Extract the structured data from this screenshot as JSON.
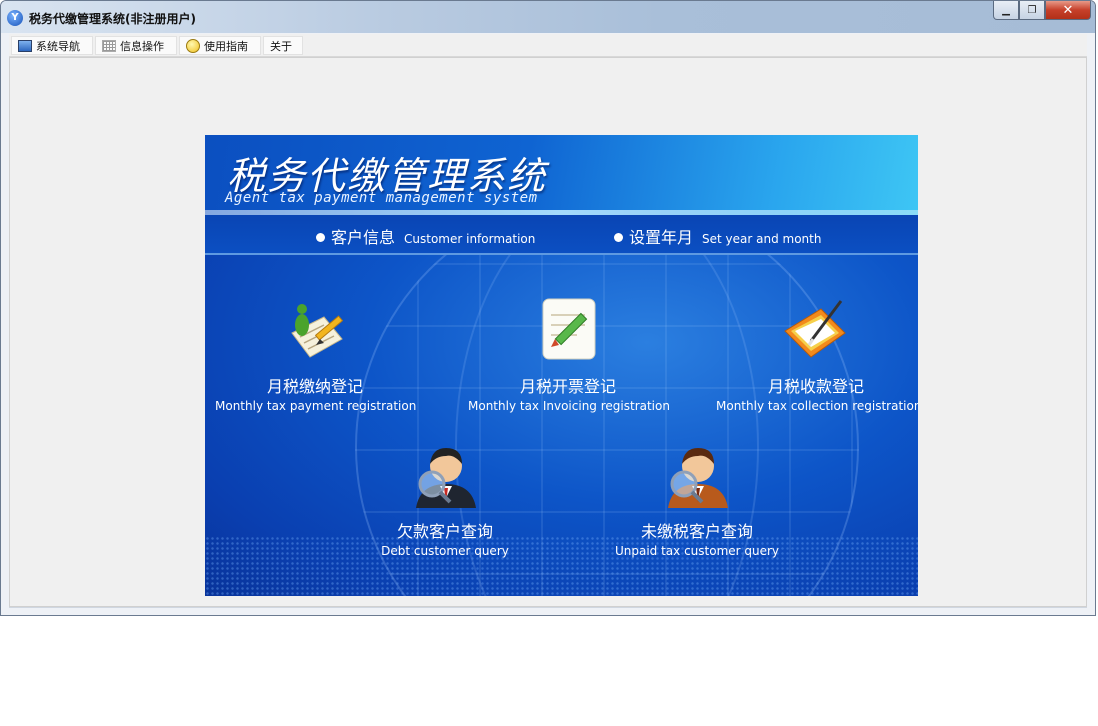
{
  "window": {
    "title": "税务代缴管理系统(非注册用户)",
    "minimize_glyph": "▁",
    "restore_glyph": "❐",
    "close_glyph": "✕"
  },
  "menu": {
    "items": [
      {
        "label": "系统导航",
        "icon": "nav-window-icon"
      },
      {
        "label": "信息操作",
        "icon": "grid-icon"
      },
      {
        "label": "使用指南",
        "icon": "smiley-icon"
      },
      {
        "label": "关于",
        "icon": ""
      }
    ]
  },
  "banner": {
    "title": "税务代缴管理系统",
    "subtitle": "Agent tax payment management system",
    "links": [
      {
        "cn": "客户信息",
        "en": "Customer information"
      },
      {
        "cn": "设置年月",
        "en": "Set year and month"
      }
    ],
    "tiles": [
      {
        "cn": "月税缴纳登记",
        "en": "Monthly tax payment registration",
        "icon": "payment-register-icon"
      },
      {
        "cn": "月税开票登记",
        "en": "Monthly tax Invoicing registration",
        "icon": "invoice-register-icon"
      },
      {
        "cn": "月税收款登记",
        "en": "Monthly tax collection registration",
        "icon": "collection-register-icon"
      },
      {
        "cn": "欠款客户查询",
        "en": "Debt customer query",
        "icon": "debt-customer-search-icon"
      },
      {
        "cn": "未缴税客户查询",
        "en": "Unpaid tax customer query",
        "icon": "unpaid-customer-search-icon"
      }
    ]
  },
  "colors": {
    "banner_blue": "#0d55c8",
    "titlebar": "#b9cbe1",
    "close_red": "#c6402a"
  }
}
